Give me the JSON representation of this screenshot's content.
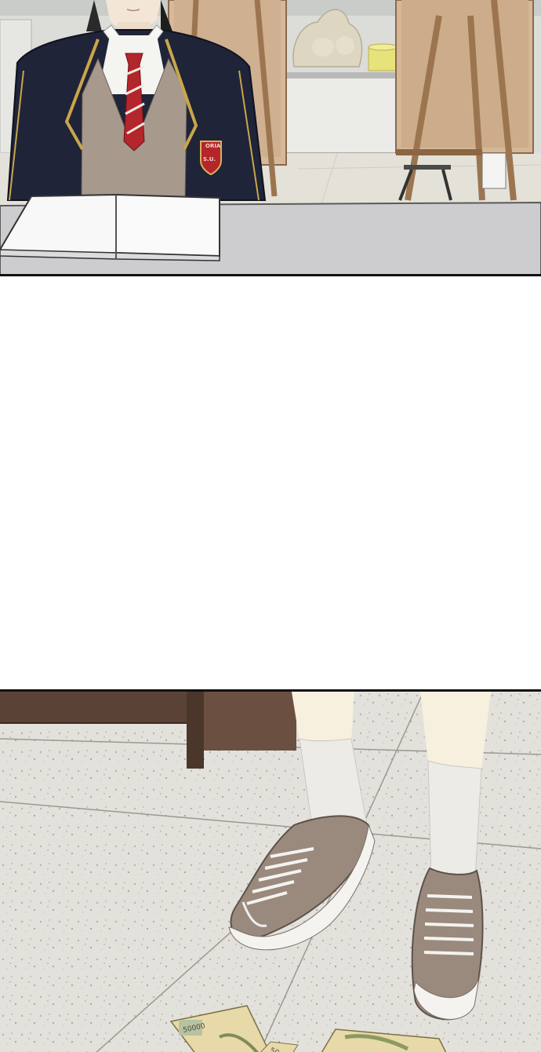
{
  "comic": {
    "panels": [
      {
        "id": "panel-1",
        "scene": "student-at-desk"
      },
      {
        "id": "panel-2",
        "scene": "blank"
      },
      {
        "id": "panel-3",
        "scene": "sneakers-and-banknotes"
      }
    ]
  },
  "badge": {
    "text": "S.U.",
    "top_text": "ORIA"
  },
  "banknote": {
    "denomination": "50000",
    "partial_denomination": "50"
  },
  "colors": {
    "blazer": "#1f2438",
    "blazer_trim": "#c9a64a",
    "tie": "#b3262c",
    "vest": "#a7998b",
    "shoe": "#9a8a7e",
    "sock": "#ecebe6",
    "floor": "#e3e1dc",
    "desk_wood": "#5a4336"
  }
}
